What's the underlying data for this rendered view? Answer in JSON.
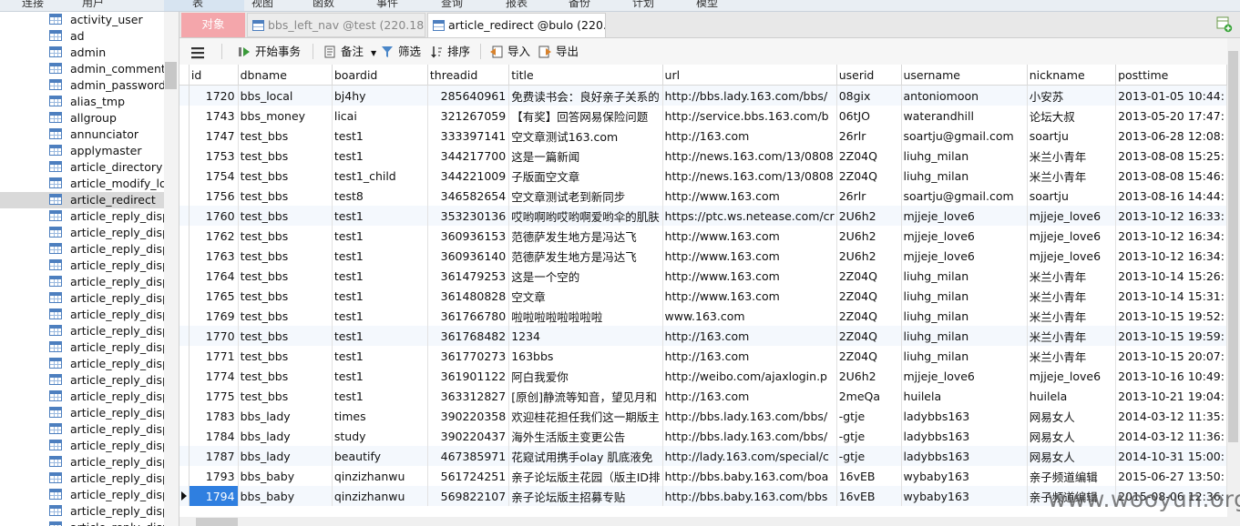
{
  "menu": {
    "items": [
      "连接",
      "用户",
      "表",
      "视图",
      "函数",
      "事件",
      "查询",
      "报表",
      "备份",
      "计划",
      "模型"
    ]
  },
  "sidebar": {
    "items": [
      "activity_user",
      "ad",
      "admin",
      "admin_comment",
      "admin_password",
      "alias_tmp",
      "allgroup",
      "annunciator",
      "applymaster",
      "article_directory",
      "article_modify_log",
      "article_redirect",
      "article_reply_displ",
      "article_reply_displ",
      "article_reply_displ",
      "article_reply_displ",
      "article_reply_displ",
      "article_reply_displ",
      "article_reply_displ",
      "article_reply_displ",
      "article_reply_displ",
      "article_reply_displ",
      "article_reply_displ",
      "article_reply_displ",
      "article_reply_displ",
      "article_reply_displ",
      "article_reply_displ",
      "article_reply_displ",
      "article_reply_displ",
      "article_reply_displ",
      "article_reply_displ",
      "article_reply_displ"
    ],
    "selected_index": 11
  },
  "tabs": {
    "objects": "对象",
    "tab1": "bbs_left_nav @test (220.181....",
    "tab2": "article_redirect @bulo (220...."
  },
  "toolbar": {
    "begin_transaction": "开始事务",
    "note": "备注",
    "filter": "筛选",
    "sort": "排序",
    "import": "导入",
    "export": "导出"
  },
  "grid": {
    "columns": [
      "id",
      "dbname",
      "boardid",
      "threadid",
      "title",
      "url",
      "userid",
      "username",
      "nickname",
      "posttime"
    ],
    "rows": [
      [
        "1720",
        "bbs_local",
        "bj4hy",
        "285640961",
        "免费读书会：良好亲子关系的",
        "http://bbs.lady.163.com/bbs/",
        "08gix",
        "antoniomoon",
        "小安苏",
        "2013-01-05 10:44:"
      ],
      [
        "1743",
        "bbs_money",
        "licai",
        "321267059",
        "【有奖】回答网易保险问题",
        "http://service.bbs.163.com/b",
        "06tJO",
        "waterandhill",
        "论坛大叔",
        "2013-05-20 17:47:"
      ],
      [
        "1747",
        "test_bbs",
        "test1",
        "333397141",
        "空文章测试163.com",
        "http://163.com",
        "26rlr",
        "soartju@gmail.com",
        "soartju",
        "2013-06-28 12:08:"
      ],
      [
        "1753",
        "test_bbs",
        "test1",
        "344217700",
        "这是一篇新闻",
        "http://news.163.com/13/0808",
        "2Z04Q",
        "liuhg_milan",
        "米兰小青年",
        "2013-08-08 15:25:"
      ],
      [
        "1754",
        "test_bbs",
        "test1_child",
        "344221009",
        "子版面空文章",
        "http://news.163.com/13/0808",
        "2Z04Q",
        "liuhg_milan",
        "米兰小青年",
        "2013-08-08 15:46:"
      ],
      [
        "1756",
        "test_bbs",
        "test8",
        "346582654",
        "空文章测试老到新同步",
        "http://www.163.com",
        "26rlr",
        "soartju@gmail.com",
        "soartju",
        "2013-08-16 14:44:"
      ],
      [
        "1760",
        "test_bbs",
        "test1",
        "353230136",
        "哎哟啊哟哎哟啊爱哟伞的肌肤",
        "https://ptc.ws.netease.com/cr",
        "2U6h2",
        "mjjeje_love6",
        "mjjeje_love6",
        "2013-10-12 16:33:"
      ],
      [
        "1762",
        "test_bbs",
        "test1",
        "360936153",
        "范德萨发生地方是冯达飞",
        "http://www.163.com",
        "2U6h2",
        "mjjeje_love6",
        "mjjeje_love6",
        "2013-10-12 16:34:"
      ],
      [
        "1763",
        "test_bbs",
        "test1",
        "360936140",
        "范德萨发生地方是冯达飞",
        "http://www.163.com",
        "2U6h2",
        "mjjeje_love6",
        "mjjeje_love6",
        "2013-10-12 16:34:"
      ],
      [
        "1764",
        "test_bbs",
        "test1",
        "361479253",
        "这是一个空的",
        "http://www.163.com",
        "2Z04Q",
        "liuhg_milan",
        "米兰小青年",
        "2013-10-14 15:26:"
      ],
      [
        "1765",
        "test_bbs",
        "test1",
        "361480828",
        "空文章",
        "http://www.163.com",
        "2Z04Q",
        "liuhg_milan",
        "米兰小青年",
        "2013-10-14 15:31:"
      ],
      [
        "1769",
        "test_bbs",
        "test1",
        "361766780",
        "啦啦啦啦啦啦啦啦",
        "www.163.com",
        "2Z04Q",
        "liuhg_milan",
        "米兰小青年",
        "2013-10-15 19:52:"
      ],
      [
        "1770",
        "test_bbs",
        "test1",
        "361768482",
        "1234",
        "http://163.com",
        "2Z04Q",
        "liuhg_milan",
        "米兰小青年",
        "2013-10-15 19:59:"
      ],
      [
        "1771",
        "test_bbs",
        "test1",
        "361770273",
        "163bbs",
        "http://163.com",
        "2Z04Q",
        "liuhg_milan",
        "米兰小青年",
        "2013-10-15 20:07:"
      ],
      [
        "1774",
        "test_bbs",
        "test1",
        "361901122",
        "阿白我爱你",
        "http://weibo.com/ajaxlogin.p",
        "2U6h2",
        "mjjeje_love6",
        "mjjeje_love6",
        "2013-10-16 10:49:"
      ],
      [
        "1775",
        "test_bbs",
        "test1",
        "363312827",
        "[原创]静流等知音，望见月和",
        "http://163.com",
        "2meQa",
        "huilela",
        "huilela",
        "2013-10-21 19:04:"
      ],
      [
        "1783",
        "bbs_lady",
        "times",
        "390220358",
        "欢迎桂花担任我们这一期版主",
        "http://bbs.lady.163.com/bbs/",
        "-gtje",
        "ladybbs163",
        "网易女人",
        "2014-03-12 11:35:"
      ],
      [
        "1784",
        "bbs_lady",
        "study",
        "390220437",
        "海外生活版主变更公告",
        "http://bbs.lady.163.com/bbs/",
        "-gtje",
        "ladybbs163",
        "网易女人",
        "2014-03-12 11:36:"
      ],
      [
        "1787",
        "bbs_lady",
        "beautify",
        "467385971",
        "花窥试用携手olay 肌底液免",
        "http://lady.163.com/special/c",
        "-gtje",
        "ladybbs163",
        "网易女人",
        "2014-10-31 15:00:"
      ],
      [
        "1793",
        "bbs_baby",
        "qinzizhanwu",
        "561724251",
        "亲子论坛版主花园（版主ID排",
        "http://bbs.baby.163.com/boa",
        "16vEB",
        "wybaby163",
        "亲子频道编辑",
        "2015-06-27 13:50:"
      ],
      [
        "1794",
        "bbs_baby",
        "qinzizhanwu",
        "569822107",
        "亲子论坛版主招募专贴",
        "http://bbs.baby.163.com/bbs",
        "16vEB",
        "wybaby163",
        "亲子频道编辑",
        "2015-08-06 12:36:"
      ]
    ],
    "current_row": 20
  },
  "watermark": "www.wooyun.org",
  "colors": {
    "accent_selected": "#2f7fe0",
    "objects_tab": "#f4a6ab",
    "row_alt": "#f4f8fd"
  }
}
